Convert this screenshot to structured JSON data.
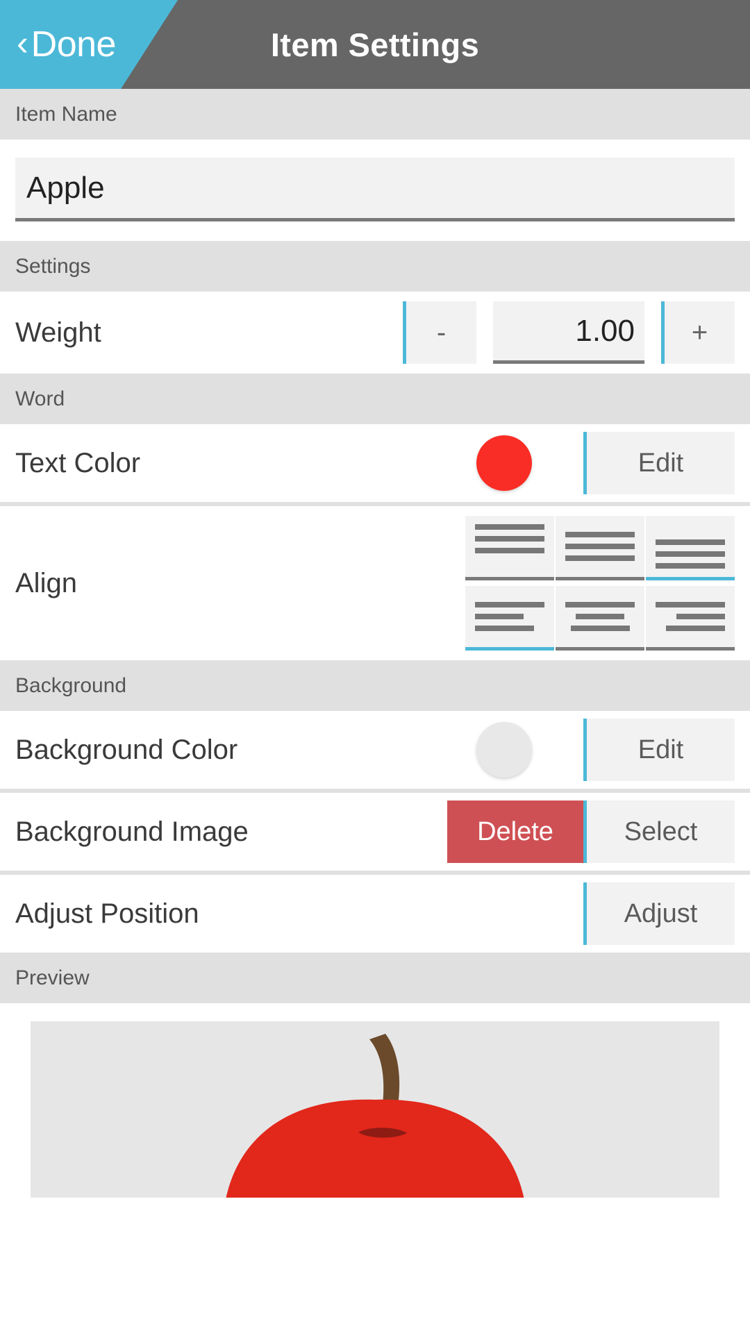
{
  "header": {
    "back_label": "Done",
    "back_icon": "chevron-left-icon",
    "title": "Item Settings",
    "accent_color": "#4cb8d8",
    "bar_color": "#666666"
  },
  "sections": {
    "item_name": {
      "header": "Item Name",
      "value": "Apple",
      "placeholder": "Item Name"
    },
    "settings": {
      "header": "Settings",
      "weight": {
        "label": "Weight",
        "minus_label": "-",
        "plus_label": "+",
        "value": "1.00"
      }
    },
    "word": {
      "header": "Word",
      "text_color": {
        "label": "Text Color",
        "edit_label": "Edit",
        "swatch_color": "#f92d25"
      },
      "align": {
        "label": "Align",
        "options": [
          {
            "name": "vertical-top",
            "selected": false
          },
          {
            "name": "vertical-middle",
            "selected": false
          },
          {
            "name": "vertical-bottom",
            "selected": true
          },
          {
            "name": "horizontal-left",
            "selected": true
          },
          {
            "name": "horizontal-center",
            "selected": false
          },
          {
            "name": "horizontal-right",
            "selected": false
          }
        ]
      }
    },
    "background": {
      "header": "Background",
      "bg_color": {
        "label": "Background Color",
        "edit_label": "Edit",
        "swatch_color": "#e8e8e8"
      },
      "bg_image": {
        "label": "Background Image",
        "delete_label": "Delete",
        "select_label": "Select",
        "delete_color": "#cf5054"
      },
      "adjust": {
        "label": "Adjust Position",
        "adjust_label": "Adjust"
      }
    },
    "preview": {
      "header": "Preview",
      "image_alt": "apple-illustration"
    }
  }
}
